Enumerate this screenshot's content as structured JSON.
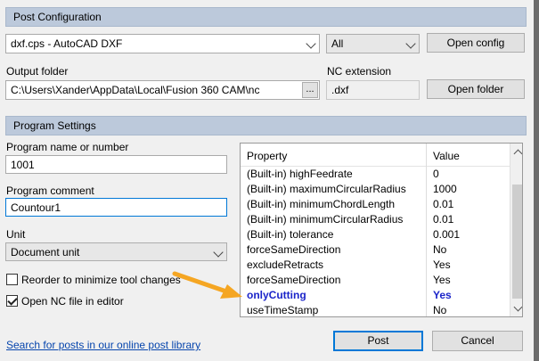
{
  "post_config": {
    "header": "Post Configuration",
    "post_select": "dxf.cps - AutoCAD DXF",
    "filter_select": "All",
    "open_config_label": "Open config",
    "output_folder_label": "Output folder",
    "output_folder_value": "C:\\Users\\Xander\\AppData\\Local\\Fusion 360 CAM\\nc",
    "browse_label": "...",
    "nc_extension_label": "NC extension",
    "nc_extension_value": ".dxf",
    "open_folder_label": "Open folder"
  },
  "program_settings": {
    "header": "Program Settings",
    "program_name_label": "Program name or number",
    "program_name_value": "1001",
    "program_comment_label": "Program comment",
    "program_comment_value": "Countour1",
    "unit_label": "Unit",
    "unit_value": "Document unit",
    "reorder_label": "Reorder to minimize tool changes",
    "reorder_checked": false,
    "open_nc_label": "Open NC file in editor",
    "open_nc_checked": true
  },
  "properties": {
    "col_property": "Property",
    "col_value": "Value",
    "rows": [
      {
        "property": "(Built-in) highFeedrate",
        "value": "0"
      },
      {
        "property": "(Built-in) maximumCircularRadius",
        "value": "1000"
      },
      {
        "property": "(Built-in) minimumChordLength",
        "value": "0.01"
      },
      {
        "property": "(Built-in) minimumCircularRadius",
        "value": "0.01"
      },
      {
        "property": "(Built-in) tolerance",
        "value": "0.001"
      },
      {
        "property": "forceSameDirection",
        "value": "No"
      },
      {
        "property": "excludeRetracts",
        "value": "Yes"
      },
      {
        "property": "forceSameDirection",
        "value": "Yes"
      },
      {
        "property": "onlyCutting",
        "value": "Yes",
        "highlighted": true
      },
      {
        "property": "useTimeStamp",
        "value": "No"
      }
    ]
  },
  "footer": {
    "search_link": "Search for posts in our online post library",
    "post_button": "Post",
    "cancel_button": "Cancel"
  },
  "colors": {
    "section_header": "#bcc9db",
    "highlight_text": "#1b24c9",
    "arrow": "#f5a623",
    "link": "#0645ad"
  }
}
